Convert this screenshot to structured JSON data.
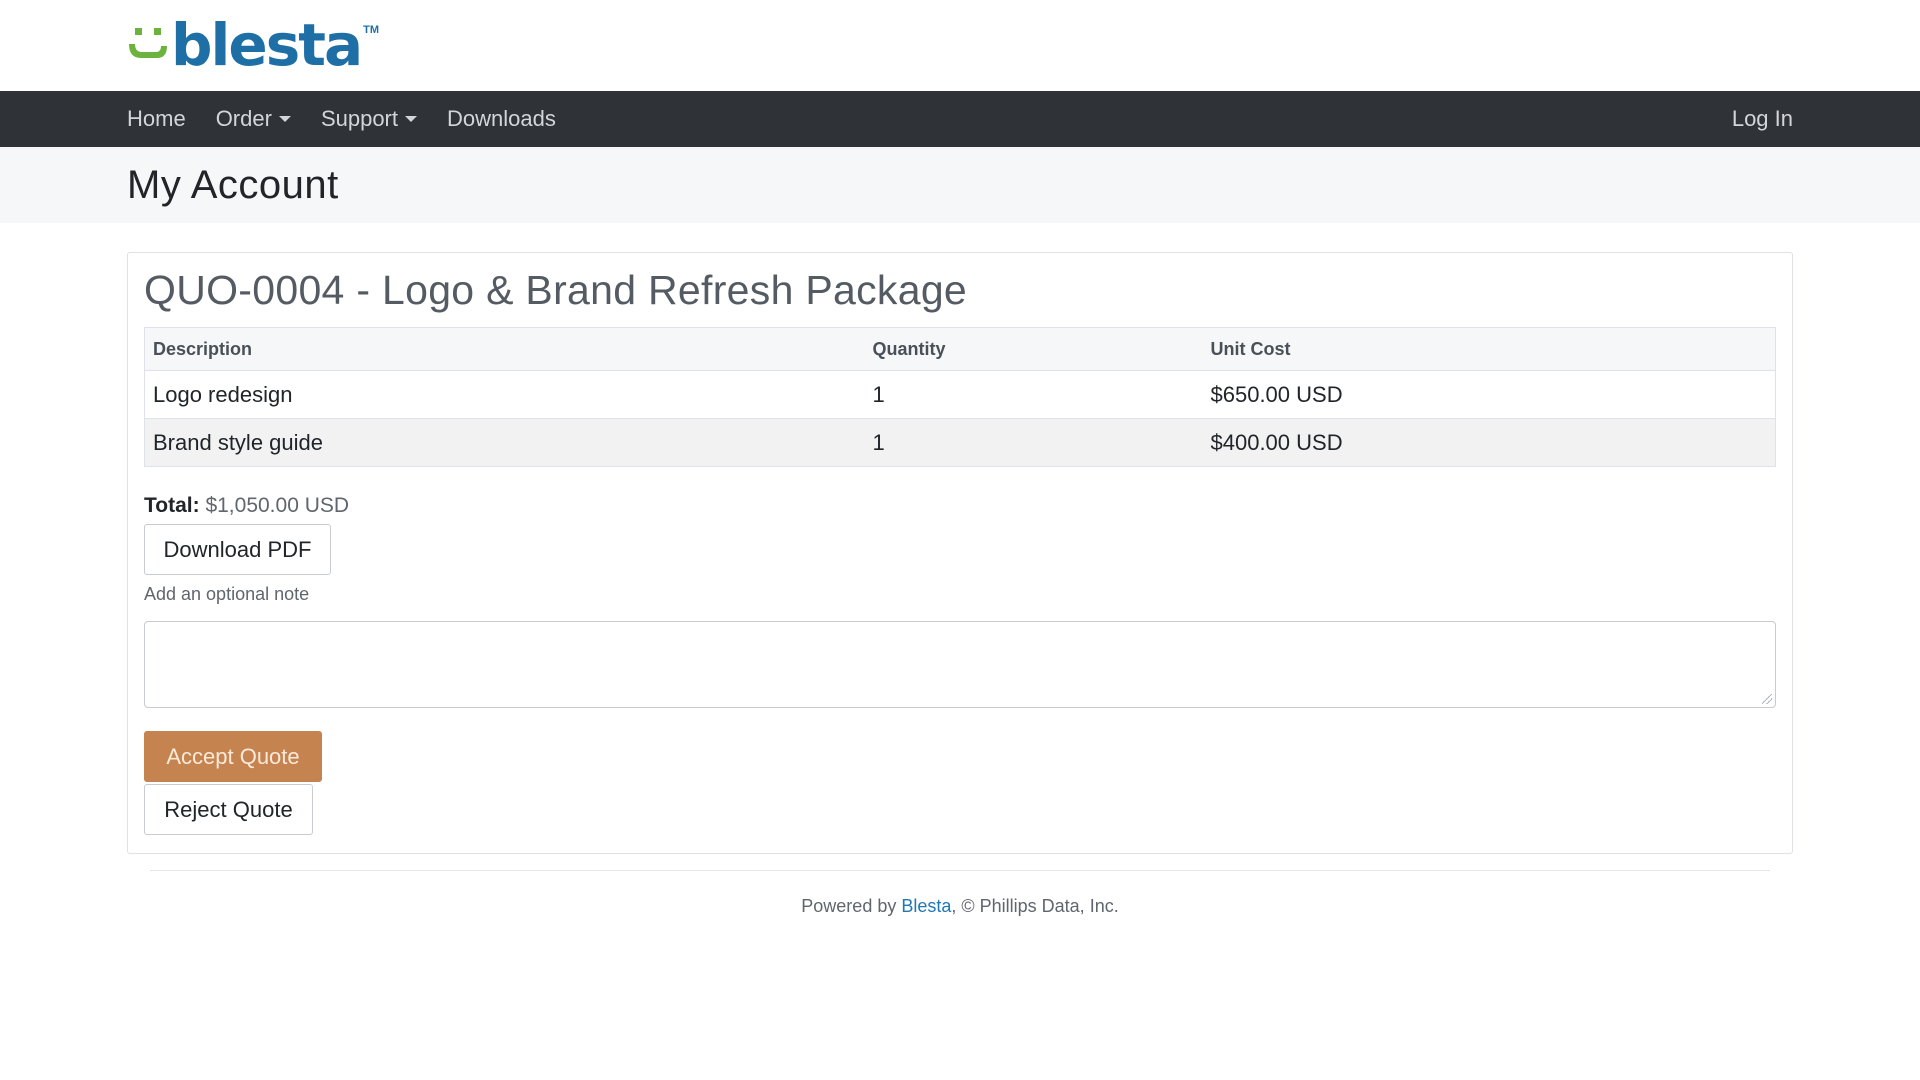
{
  "brand": {
    "wordmark": "blesta",
    "trademark": "TM",
    "colors": {
      "icon": "#6cb33e",
      "wordmark": "#1f6fa7"
    }
  },
  "nav": {
    "items": [
      {
        "label": "Home",
        "dropdown": false
      },
      {
        "label": "Order",
        "dropdown": true
      },
      {
        "label": "Support",
        "dropdown": true
      },
      {
        "label": "Downloads",
        "dropdown": false
      }
    ],
    "login_label": "Log In"
  },
  "page": {
    "title": "My Account"
  },
  "quote": {
    "heading": "QUO-0004 - Logo & Brand Refresh Package",
    "table": {
      "headers": [
        "Description",
        "Quantity",
        "Unit Cost"
      ],
      "rows": [
        {
          "description": "Logo redesign",
          "quantity": "1",
          "unit_cost": "$650.00 USD"
        },
        {
          "description": "Brand style guide",
          "quantity": "1",
          "unit_cost": "$400.00 USD"
        }
      ]
    },
    "total_label": "Total:",
    "total_value": "$1,050.00 USD",
    "download_pdf_label": "Download PDF",
    "note_label": "Add an optional note",
    "note_value": "",
    "accept_label": "Accept Quote",
    "reject_label": "Reject Quote",
    "accent_color": "#c5844f"
  },
  "footer": {
    "prefix": "Powered by ",
    "link_text": "Blesta",
    "suffix": ", © Phillips Data, Inc."
  }
}
